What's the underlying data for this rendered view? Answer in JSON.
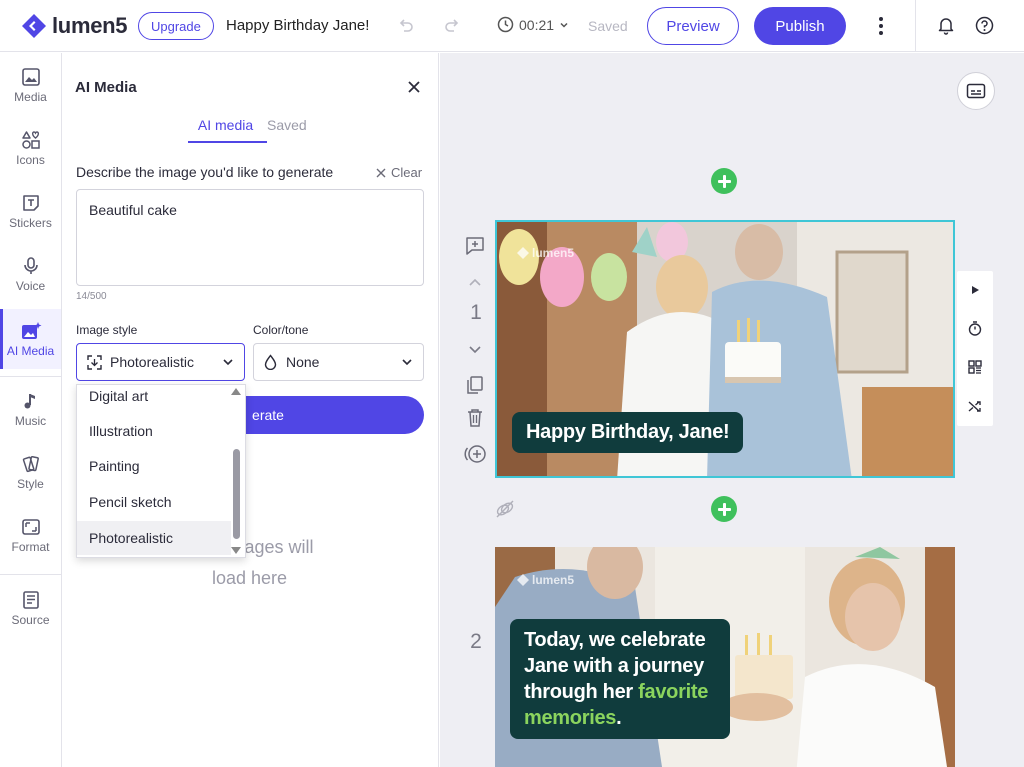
{
  "brand": {
    "logo_text": "lumen5",
    "accent": "#5046e5",
    "success": "#3fc05c"
  },
  "topbar": {
    "upgrade_label": "Upgrade",
    "project_title": "Happy Birthday Jane!",
    "duration": "00:21",
    "save_status": "Saved",
    "preview_label": "Preview",
    "publish_label": "Publish",
    "icons": [
      "undo-icon",
      "redo-icon",
      "clock-icon",
      "kebab-icon",
      "bell-icon",
      "help-icon"
    ]
  },
  "rail": {
    "items": [
      {
        "label": "Media",
        "icon": "image-icon"
      },
      {
        "label": "Icons",
        "icon": "shapes-icon"
      },
      {
        "label": "Stickers",
        "icon": "sticker-icon"
      },
      {
        "label": "Voice",
        "icon": "microphone-icon"
      },
      {
        "label": "AI Media",
        "icon": "ai-image-icon",
        "active": true
      },
      {
        "label": "Music",
        "icon": "music-note-icon"
      },
      {
        "label": "Style",
        "icon": "palette-icon"
      },
      {
        "label": "Format",
        "icon": "format-icon"
      },
      {
        "label": "Source",
        "icon": "document-icon"
      }
    ]
  },
  "panel": {
    "title": "AI Media",
    "tabs": [
      {
        "label": "AI media",
        "active": true
      },
      {
        "label": "Saved"
      }
    ],
    "describe_label": "Describe the image you'd like to generate",
    "clear_label": "Clear",
    "prompt_value": "Beautiful cake",
    "char_count": "14/500",
    "image_style_label": "Image style",
    "image_style_value": "Photorealistic",
    "color_tone_label": "Color/tone",
    "color_tone_value": "None",
    "generate_label": "Generate",
    "generate_visible": "erate",
    "empty_message": "Your images will load here",
    "empty_visible_line1": "images will",
    "empty_visible_line2": "load here",
    "style_options": [
      {
        "label": "Digital art"
      },
      {
        "label": "Illustration"
      },
      {
        "label": "Painting"
      },
      {
        "label": "Pencil sketch"
      },
      {
        "label": "Photorealistic",
        "selected": true
      }
    ]
  },
  "canvas": {
    "scenes": [
      {
        "number": "1",
        "watermark": "lumen5",
        "caption": "Happy Birthday, Jane!"
      },
      {
        "number": "2",
        "watermark": "lumen5",
        "caption_parts": [
          "Today, we celebrate Jane with a journey through her ",
          "favorite memories",
          "."
        ],
        "highlight_color": "#8bd45e"
      }
    ],
    "caption_bg": "#103c3d",
    "selected_border": "#3fc6d6"
  }
}
